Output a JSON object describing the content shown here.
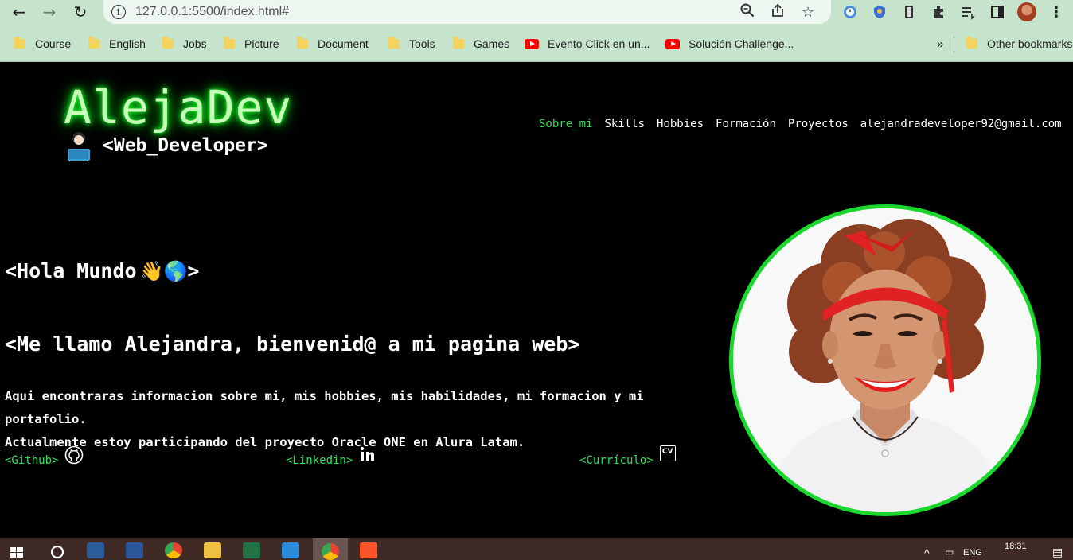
{
  "browser": {
    "url": "127.0.0.1:5500/index.html#",
    "bookmarks": [
      {
        "label": "Course",
        "type": "folder"
      },
      {
        "label": "English",
        "type": "folder"
      },
      {
        "label": "Jobs",
        "type": "folder"
      },
      {
        "label": "Picture",
        "type": "folder"
      },
      {
        "label": "Document",
        "type": "folder"
      },
      {
        "label": "Tools",
        "type": "folder"
      },
      {
        "label": "Games",
        "type": "folder"
      },
      {
        "label": "Evento Click en un...",
        "type": "youtube"
      },
      {
        "label": "Solución Challenge...",
        "type": "youtube"
      }
    ],
    "overflow_label": "»",
    "other_bookmarks": "Other bookmarks"
  },
  "site": {
    "logo": "AlejaDev",
    "tagline": "<Web_Developer>",
    "nav": [
      {
        "label": "Sobre_mi",
        "active": true
      },
      {
        "label": "Skills",
        "active": false
      },
      {
        "label": "Hobbies",
        "active": false
      },
      {
        "label": "Formación",
        "active": false
      },
      {
        "label": "Proyectos",
        "active": false
      },
      {
        "label": "alejandradeveloper92@gmail.com",
        "active": false
      }
    ],
    "greeting_open": "<Hola Mundo",
    "greeting_emojis": "👋🌎",
    "greeting_close": ">",
    "welcome": "<Me llamo Alejandra, bienvenid@ a mi pagina web>",
    "description": [
      "Aqui encontraras informacion sobre mi, mis hobbies, mis habilidades, mi formacion y mi portafolio.",
      "Actualmente estoy participando del proyecto Oracle ONE en Alura Latam."
    ],
    "links": {
      "github": "<Github>",
      "linkedin": "<Linkedin>",
      "curriculo": "<Currículo>",
      "cv_badge": "CV"
    },
    "accent_color": "#2fe05b"
  },
  "taskbar": {
    "time": "18:31",
    "lang": "ENG"
  }
}
